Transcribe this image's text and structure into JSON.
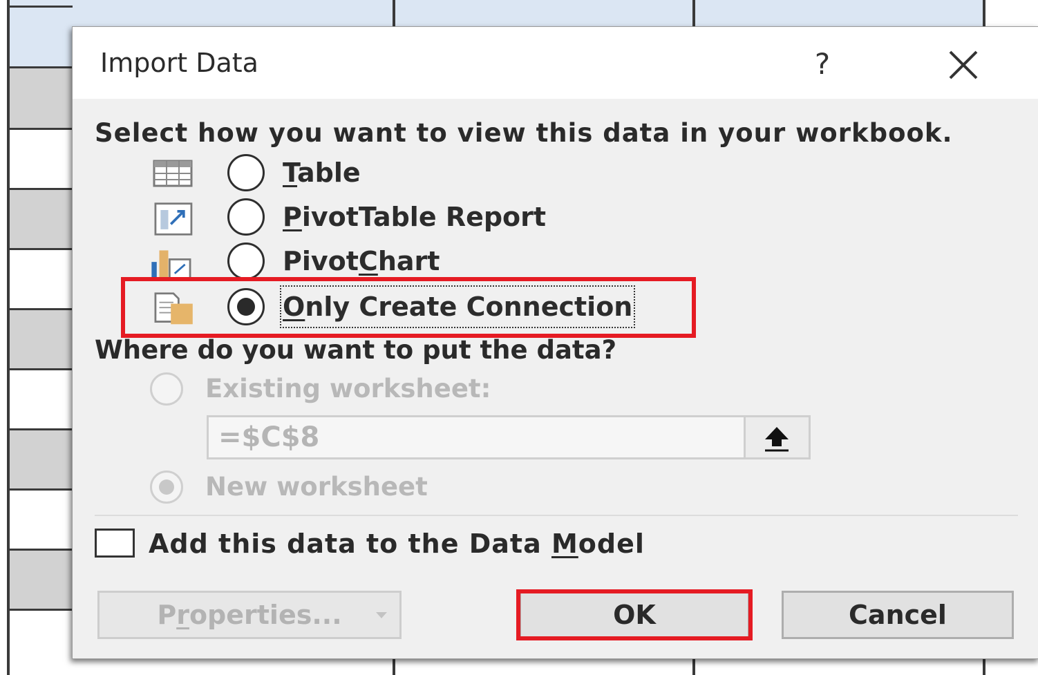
{
  "dialog": {
    "title": "Import Data",
    "help_label": "?",
    "prompt": "Select how you want to view this data in your workbook.",
    "view_options": [
      {
        "label_pre": "",
        "label_key": "T",
        "label_post": "able",
        "icon": "table-icon",
        "checked": false
      },
      {
        "label_pre": "",
        "label_key": "P",
        "label_post": "ivotTable Report",
        "icon": "pivottable-icon",
        "checked": false
      },
      {
        "label_pre": "Pivot",
        "label_key": "C",
        "label_post": "hart",
        "icon": "pivotchart-icon",
        "checked": false
      },
      {
        "label_pre": "",
        "label_key": "O",
        "label_post": "nly Create Connection",
        "icon": "connection-icon",
        "checked": true
      }
    ],
    "where_prompt": "Where do you want to put the data?",
    "existing_worksheet_label": "Existing worksheet:",
    "range_value": "=$C$8",
    "new_worksheet_label": "New worksheet",
    "new_worksheet_checked": true,
    "data_model": {
      "label_pre": "Add this data to the Data ",
      "label_key": "M",
      "label_post": "odel",
      "checked": false
    },
    "buttons": {
      "properties_pre": "P",
      "properties_key": "r",
      "properties_post": "operties...",
      "ok": "OK",
      "cancel": "Cancel"
    }
  },
  "colors": {
    "highlight": "#e51b23",
    "dialog_bg": "#f0f0f0"
  }
}
